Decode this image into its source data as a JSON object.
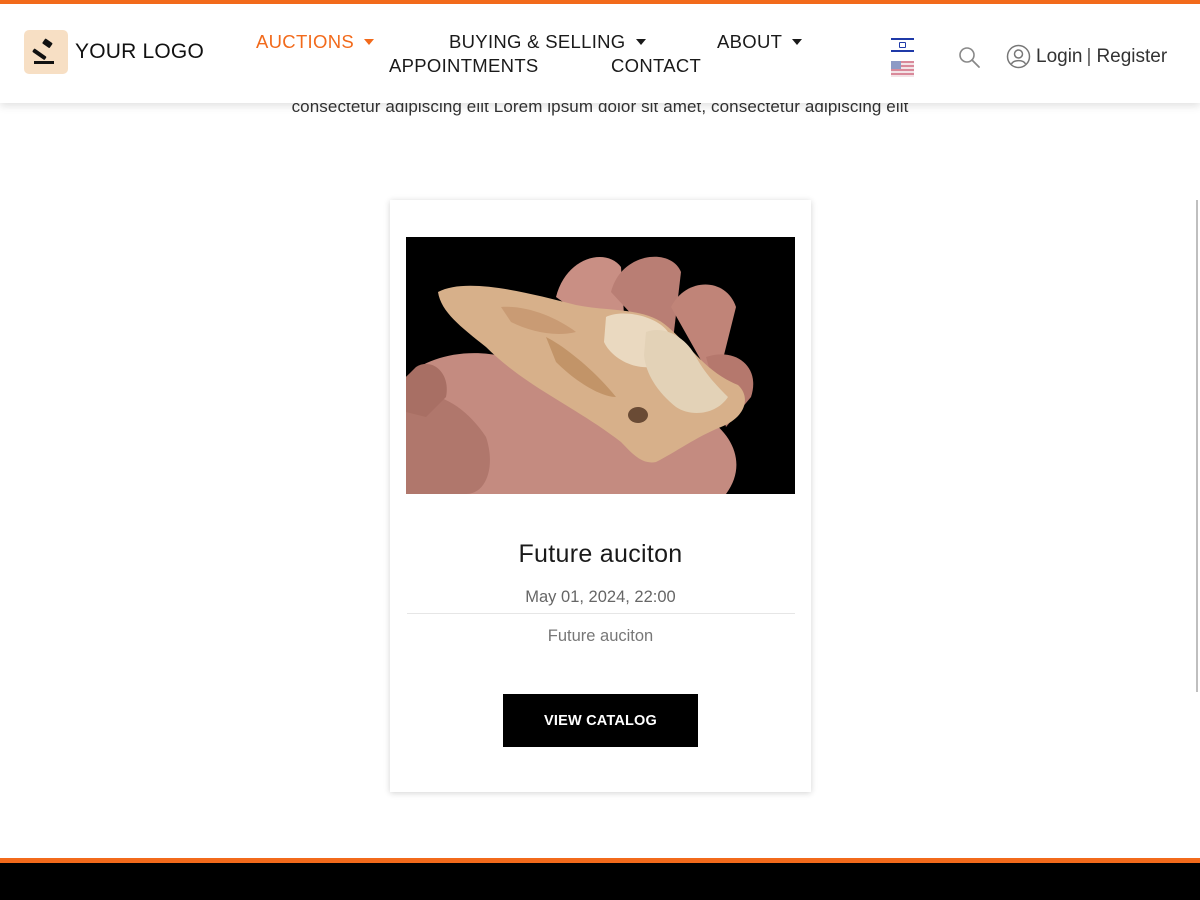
{
  "header": {
    "logo_text": "YOUR LOGO",
    "nav": {
      "auctions": "AUCTIONS",
      "buying_selling": "BUYING & SELLING",
      "about": "ABOUT",
      "appointments": "APPOINTMENTS",
      "contact": "CONTACT"
    },
    "account": {
      "login": "Login",
      "separator": "|",
      "register": "Register"
    },
    "icons": {
      "logo": "gavel-icon",
      "search": "search-icon",
      "user": "user-circle-icon",
      "flag_hebrew": "israel-flag-icon",
      "flag_english": "us-flag-icon"
    }
  },
  "intro": {
    "text": "consectetur adipiscing elit Lorem ipsum dolor sit amet, consectetur adipiscing elit"
  },
  "card": {
    "title": "Future auciton",
    "date": "May 01, 2024, 22:00",
    "description": "Future auciton",
    "button_label": "VIEW CATALOG"
  },
  "colors": {
    "accent": "#f26a1b",
    "footer": "#000000",
    "button": "#000000"
  }
}
